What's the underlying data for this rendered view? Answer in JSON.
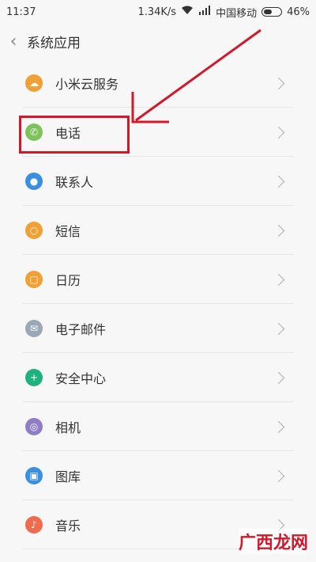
{
  "status": {
    "time": "11:37",
    "speed": "1.34K/s",
    "carrier": "中国移动",
    "battery": "46%"
  },
  "header": {
    "title": "系统应用"
  },
  "items": [
    {
      "label": "小米云服务",
      "icon": "cloud-icon",
      "color": "#f0a035"
    },
    {
      "label": "电话",
      "icon": "phone-icon",
      "color": "#7cc35b"
    },
    {
      "label": "联系人",
      "icon": "person-icon",
      "color": "#3a8fe0"
    },
    {
      "label": "短信",
      "icon": "message-icon",
      "color": "#f0a035"
    },
    {
      "label": "日历",
      "icon": "calendar-icon",
      "color": "#f0a035"
    },
    {
      "label": "电子邮件",
      "icon": "mail-icon",
      "color": "#9aa7b5"
    },
    {
      "label": "安全中心",
      "icon": "shield-icon",
      "color": "#1fb17e"
    },
    {
      "label": "相机",
      "icon": "camera-icon",
      "color": "#8f7dc8"
    },
    {
      "label": "图库",
      "icon": "gallery-icon",
      "color": "#3a8fe0"
    },
    {
      "label": "音乐",
      "icon": "music-icon",
      "color": "#f06b4e"
    }
  ],
  "annotation": {
    "highlight_color": "#d0192b"
  },
  "watermark": {
    "text": "广西龙网"
  }
}
